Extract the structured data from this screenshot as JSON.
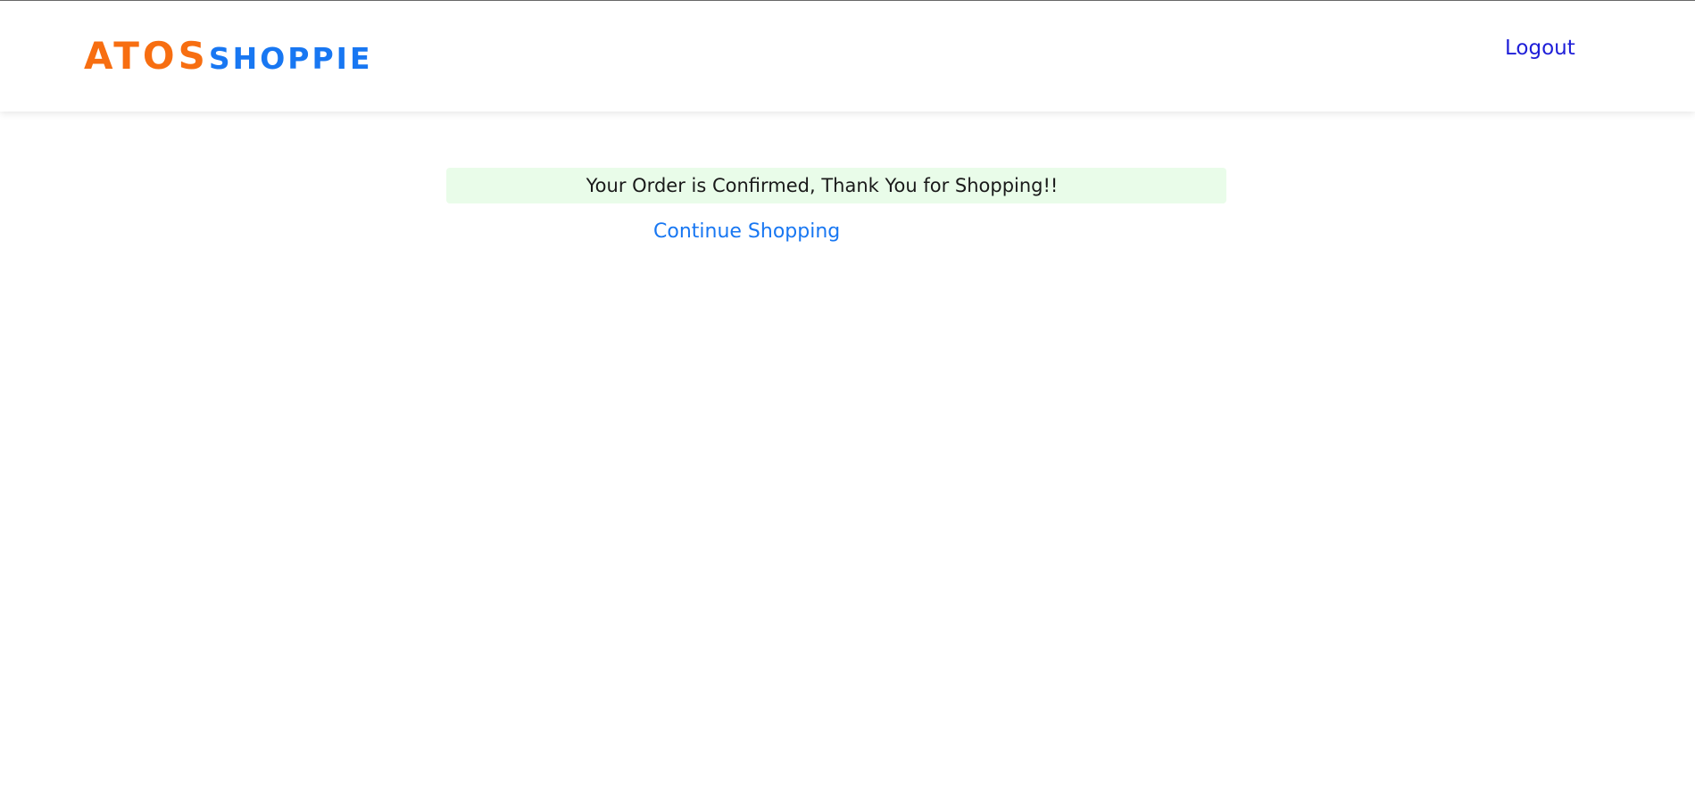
{
  "header": {
    "brand": {
      "part1": "ATOS",
      "part2": "SHOPPIE",
      "part1_color": "#f76e11",
      "part2_color": "#1877f2"
    },
    "logout_label": "Logout"
  },
  "main": {
    "confirmation_message": "Your Order is Confirmed, Thank You for Shopping!!",
    "continue_label": "Continue Shopping"
  },
  "colors": {
    "alert_background": "#e9fce9",
    "link": "#1877f2",
    "logout_link": "#1e1ed8"
  }
}
